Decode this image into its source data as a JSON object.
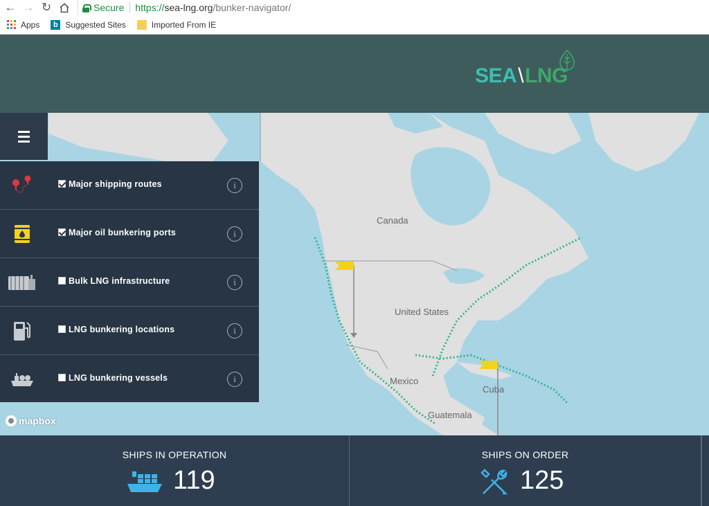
{
  "browser": {
    "back_icon": "arrow-left-icon",
    "forward_icon": "arrow-right-icon",
    "reload_icon": "reload-icon",
    "home_icon": "home-icon",
    "secure_label": "Secure",
    "url_scheme": "https://",
    "url_host": "sea-lng.org",
    "url_path": "/bunker-navigator/",
    "bookmarks": [
      {
        "label": "Apps",
        "icon": "apps-grid-icon"
      },
      {
        "label": "Suggested Sites",
        "icon": "bing-icon"
      },
      {
        "label": "Imported From IE",
        "icon": "folder-icon"
      }
    ]
  },
  "header": {
    "logo_sea": "SEA",
    "logo_slash": "\\",
    "logo_lng": "LNG",
    "colors": {
      "header_bg": "#3e5c5c",
      "sea": "#3cbfb0",
      "lng": "#3da86a"
    }
  },
  "map": {
    "labels": [
      "Canada",
      "United States",
      "Mexico",
      "Cuba",
      "Guatemala"
    ],
    "attribution": "mapbox",
    "colors": {
      "ocean": "#a9d4e3",
      "land": "#e0e0e0",
      "route": "#2bb58a",
      "flag": "#f2d21b"
    }
  },
  "layers": [
    {
      "label": "Major shipping routes",
      "checked": true,
      "icon": "route-pin-icon"
    },
    {
      "label": "Major oil bunkering ports",
      "checked": true,
      "icon": "oil-barrel-icon"
    },
    {
      "label": "Bulk LNG infrastructure",
      "checked": false,
      "icon": "lng-tank-icon"
    },
    {
      "label": "LNG bunkering locations",
      "checked": false,
      "icon": "fuel-pump-icon"
    },
    {
      "label": "LNG bunkering vessels",
      "checked": false,
      "icon": "bunker-vessel-icon"
    }
  ],
  "stats": [
    {
      "title": "SHIPS IN OPERATION",
      "value": "119",
      "icon": "cargo-ship-icon"
    },
    {
      "title": "SHIPS ON ORDER",
      "value": "125",
      "icon": "wrench-screwdriver-icon"
    }
  ]
}
